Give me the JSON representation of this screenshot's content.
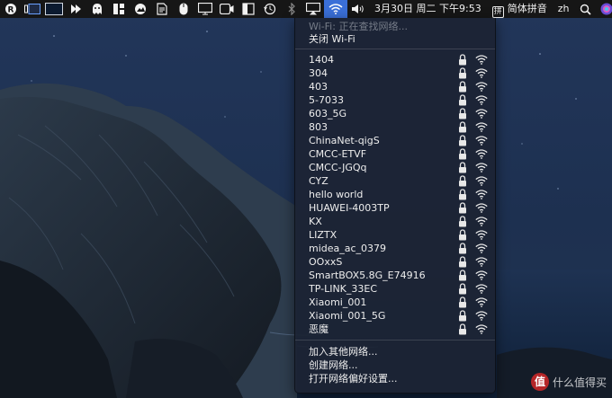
{
  "menubar": {
    "date_time": "3月30日 周二 下午9:53",
    "input_method_badge": "拼",
    "input_method": "简体拼音",
    "language": "zh"
  },
  "wifi_menu": {
    "status": "Wi-Fi: 正在查找网络...",
    "toggle_label": "关闭 Wi-Fi",
    "networks": [
      {
        "name": "1404",
        "locked": true
      },
      {
        "name": "304",
        "locked": true
      },
      {
        "name": "403",
        "locked": true
      },
      {
        "name": "5-7033",
        "locked": true
      },
      {
        "name": "603_5G",
        "locked": true
      },
      {
        "name": "803",
        "locked": true
      },
      {
        "name": "ChinaNet-qigS",
        "locked": true
      },
      {
        "name": "CMCC-ETVF",
        "locked": true
      },
      {
        "name": "CMCC-JGQq",
        "locked": true
      },
      {
        "name": "CYZ",
        "locked": true
      },
      {
        "name": "hello world",
        "locked": true
      },
      {
        "name": "HUAWEI-4003TP",
        "locked": true
      },
      {
        "name": "KX",
        "locked": true
      },
      {
        "name": "LIZTX",
        "locked": true
      },
      {
        "name": "midea_ac_0379",
        "locked": true
      },
      {
        "name": "OOxxS",
        "locked": true
      },
      {
        "name": "SmartBOX5.8G_E74916",
        "locked": true
      },
      {
        "name": "TP-LINK_33EC",
        "locked": true
      },
      {
        "name": "Xiaomi_001",
        "locked": true
      },
      {
        "name": "Xiaomi_001_5G",
        "locked": true
      },
      {
        "name": "恶魔",
        "locked": true
      }
    ],
    "join_other": "加入其他网络...",
    "create_network": "创建网络...",
    "open_prefs": "打开网络偏好设置..."
  },
  "watermark": {
    "logo": "值",
    "text": "什么值得买"
  },
  "colors": {
    "menubar_bg": "#161616",
    "menu_bg": "#1c2434",
    "highlight": "#3a6fd8",
    "disabled_text": "#767c88"
  }
}
